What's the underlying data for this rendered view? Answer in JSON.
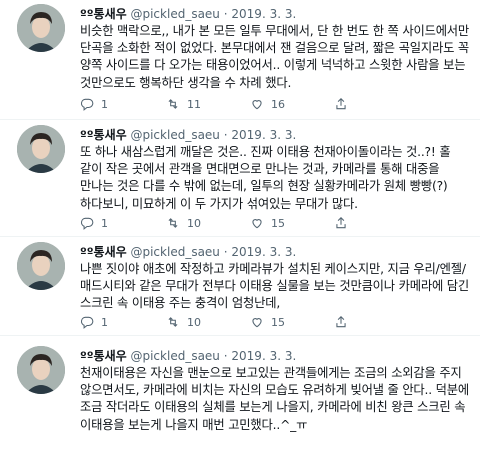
{
  "tweets": [
    {
      "name": "ºº통새우",
      "handle": "@pickled_saeu",
      "separator": "·",
      "date": "2019. 3. 3.",
      "text": "비슷한 맥락으로,, 내가 본 모든 일투 무대에서, 단 한 번도 한 쪽 사이드에서만 단곡을 소화한 적이 없었다. 본무대에서 잰 걸음으로 달려, 짧은 곡일지라도 꼭 양쪽 사이드를 다 오가는 태용이었어서.. 이렇게 넉넉하고 스윗한 사람을 보는 것만으로도 행복하단 생각을 수 차례 했다.",
      "actions": {
        "replies": "1",
        "retweets": "11",
        "likes": "16"
      }
    },
    {
      "name": "ºº통새우",
      "handle": "@pickled_saeu",
      "separator": "·",
      "date": "2019. 3. 3.",
      "text": "또 하나 새삼스럽게 깨달은 것은.. 진짜 이태용 천재아이돌이라는 것..?! 홀 같이 작은 곳에서 관객을 면대면으로 만나는 것과, 카메라를 통해 대중을 만나는 것은 다를 수 밖에 없는데, 일투의 현장 실황카메라가 원체 빵빵(?)하다보니, 미묘하게 이 두 가지가 섞여있는 무대가 많다.",
      "actions": {
        "replies": "1",
        "retweets": "10",
        "likes": "15"
      }
    },
    {
      "name": "ºº통새우",
      "handle": "@pickled_saeu",
      "separator": "·",
      "date": "2019. 3. 3.",
      "text": "나쁜 짓이야 애초에 작정하고 카메라뷰가 설치된 케이스지만, 지금 우리/엔젤/매드시티와 같은 무대가 전부다 이태용 실물을 보는 것만큼이나 카메라에 담긴 스크린 속 이태용 주는 충격이 엄청난데,",
      "actions": {
        "replies": "1",
        "retweets": "10",
        "likes": "15"
      }
    },
    {
      "name": "ºº통새우",
      "handle": "@pickled_saeu",
      "separator": "·",
      "date": "2019. 3. 3.",
      "text": "천재이태용은 자신을 맨눈으로 보고있는 관객들에게는 조금의 소외감을 주지 않으면서도, 카메라에 비치는 자신의 모습도 유려하게 빚어낼 줄 안다.. 덕분에 조금 작더라도 이태용의 실체를 보는게 나을지, 카메라에 비친 왕큰 스크린 속 이태용을 보는게 나을지 매번 고민했다..^_ㅠ",
      "actions": {
        "replies": "",
        "retweets": "",
        "likes": ""
      }
    }
  ],
  "colors": {
    "text": "#0f1419",
    "muted": "#536471",
    "divider": "#eff3f4"
  },
  "icons": [
    "reply-icon",
    "retweet-icon",
    "like-icon",
    "share-icon"
  ]
}
